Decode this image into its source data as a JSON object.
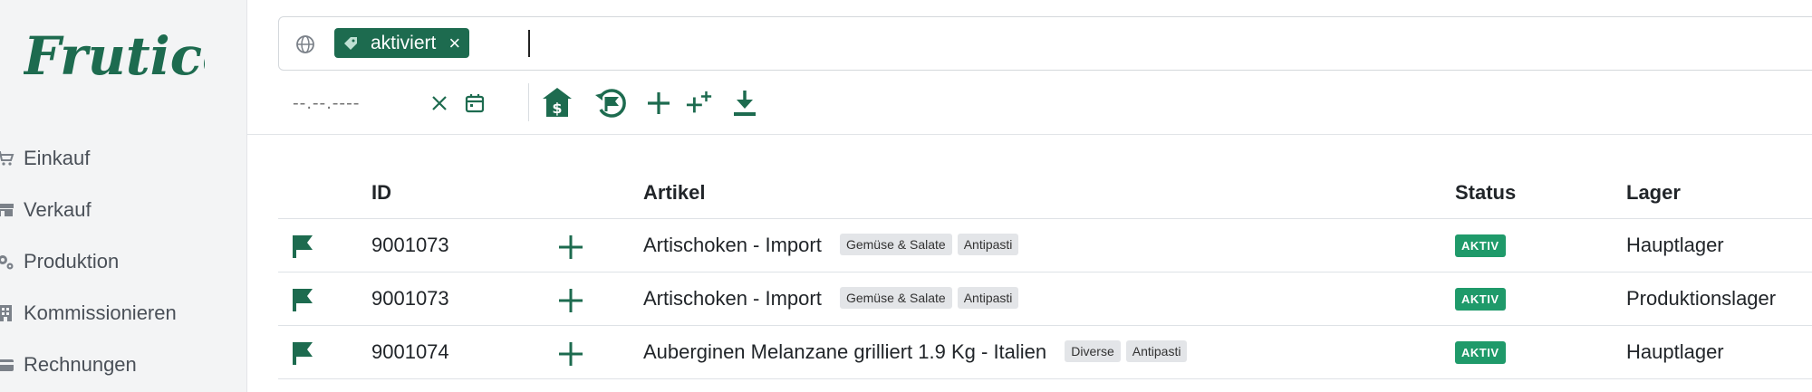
{
  "brand": {
    "logo_text": "Frutico",
    "color": "#1d6b4f"
  },
  "sidebar": {
    "items": [
      {
        "label": "Einkauf",
        "icon": "cart-icon"
      },
      {
        "label": "Verkauf",
        "icon": "store-icon"
      },
      {
        "label": "Produktion",
        "icon": "gears-icon"
      },
      {
        "label": "Kommissionieren",
        "icon": "building-icon"
      },
      {
        "label": "Rechnungen",
        "icon": "card-icon"
      }
    ]
  },
  "search": {
    "scope_icon": "globe-icon",
    "tag_label": "aktiviert",
    "tag_icon": "tag-icon"
  },
  "toolbar": {
    "date_placeholder": "--.--.----",
    "icons": [
      "clear-icon",
      "calendar-icon",
      "warehouse-money-icon",
      "flag-restore-icon",
      "plus-icon",
      "plus-multiple-icon",
      "download-icon"
    ]
  },
  "table": {
    "headers": {
      "id": "ID",
      "artikel": "Artikel",
      "status": "Status",
      "lager": "Lager"
    },
    "rows": [
      {
        "id": "9001073",
        "artikel": "Artischoken - Import",
        "tags": [
          "Gemüse & Salate",
          "Antipasti"
        ],
        "status": "AKTIV",
        "lager": "Hauptlager"
      },
      {
        "id": "9001073",
        "artikel": "Artischoken - Import",
        "tags": [
          "Gemüse & Salate",
          "Antipasti"
        ],
        "status": "AKTIV",
        "lager": "Produktionslager"
      },
      {
        "id": "9001074",
        "artikel": "Auberginen Melanzane grilliert 1.9 Kg - Italien",
        "tags": [
          "Diverse",
          "Antipasti"
        ],
        "status": "AKTIV",
        "lager": "Hauptlager"
      }
    ]
  },
  "colors": {
    "primary": "#1d6b4f",
    "status_green": "#1f9a6a",
    "sidebar_bg": "#f3f4f5"
  }
}
